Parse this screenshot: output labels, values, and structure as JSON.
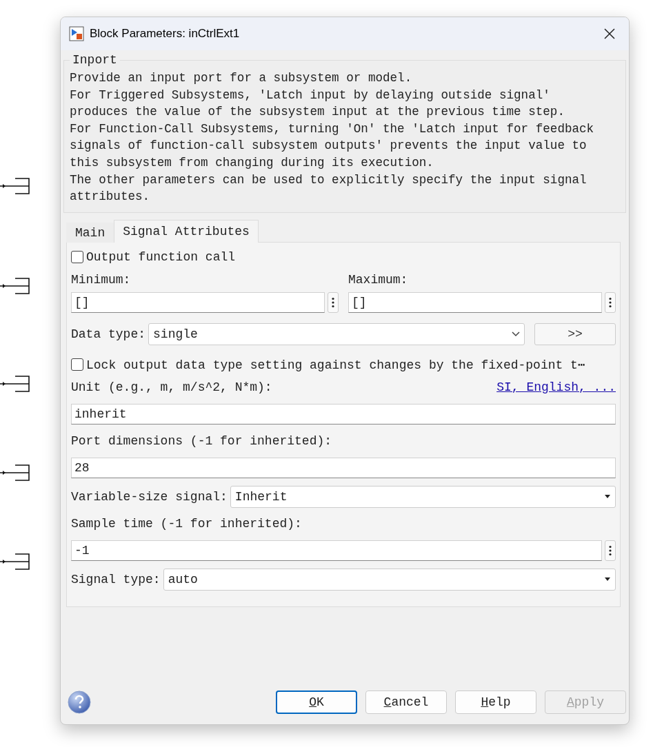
{
  "window": {
    "title": "Block Parameters: inCtrlExt1"
  },
  "description": {
    "group": "Inport",
    "lines": [
      "Provide an input port for a subsystem or model.",
      "For Triggered Subsystems, 'Latch input by delaying outside signal'",
      "produces the value of the subsystem input at the previous time step.",
      "For Function-Call Subsystems, turning 'On' the 'Latch input for feedback",
      "signals of function-call subsystem outputs' prevents the input value to",
      "this subsystem from changing during its execution.",
      "The other parameters can be used to explicitly specify the input signal",
      "attributes."
    ]
  },
  "tabs": [
    {
      "label": "Main",
      "selected": false
    },
    {
      "label": "Signal Attributes",
      "selected": true
    }
  ],
  "output_function_call": {
    "label": "Output function call",
    "checked": false
  },
  "minimum": {
    "label": "Minimum:",
    "value": "[]"
  },
  "maximum": {
    "label": "Maximum:",
    "value": "[]"
  },
  "data_type": {
    "label": "Data type:",
    "value": "single",
    "assistant_button": ">>"
  },
  "lock_output": {
    "label": "Lock output data type setting against changes by the fixed-point t⋯",
    "checked": false
  },
  "unit": {
    "label": "Unit (e.g., m, m/s^2, N*m):",
    "link": "SI, English, ...",
    "value": "inherit"
  },
  "port_dimensions": {
    "label": "Port dimensions (-1 for inherited):",
    "value": "28"
  },
  "variable_size": {
    "label": "Variable-size signal:",
    "value": "Inherit"
  },
  "sample_time": {
    "label": "Sample time (-1 for inherited):",
    "value": "-1"
  },
  "signal_type": {
    "label": "Signal type:",
    "value": "auto"
  },
  "buttons": [
    {
      "label": "OK",
      "default": true,
      "disabled": false
    },
    {
      "label": "Cancel",
      "default": false,
      "disabled": false
    },
    {
      "label": "Help",
      "default": false,
      "disabled": false
    },
    {
      "label": "Apply",
      "default": false,
      "disabled": true
    }
  ]
}
